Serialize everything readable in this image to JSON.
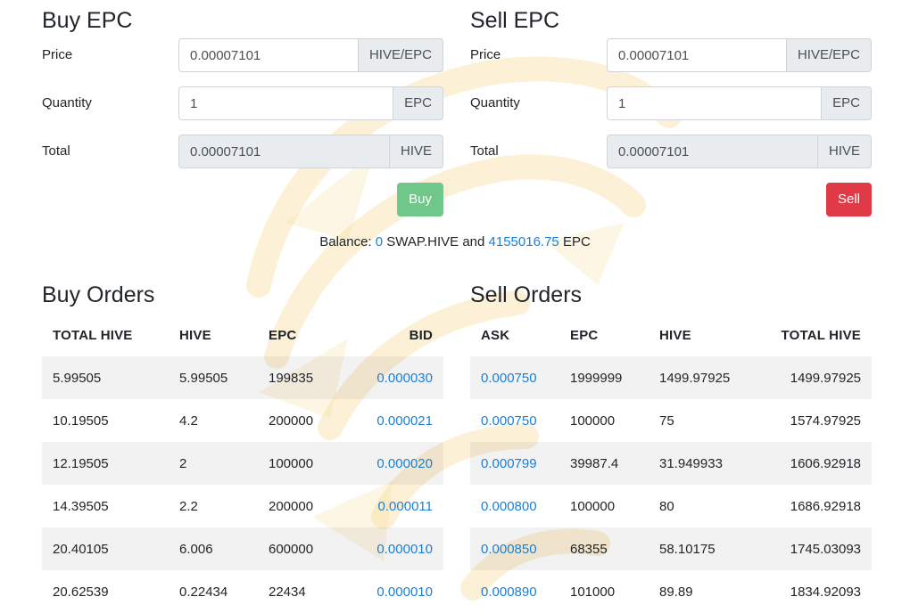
{
  "buy_form": {
    "title": "Buy EPC",
    "price_label": "Price",
    "price_value": "0.00007101",
    "price_unit": "HIVE/EPC",
    "quantity_label": "Quantity",
    "quantity_value": "1",
    "quantity_unit": "EPC",
    "total_label": "Total",
    "total_value": "0.00007101",
    "total_unit": "HIVE",
    "button_label": "Buy"
  },
  "sell_form": {
    "title": "Sell EPC",
    "price_label": "Price",
    "price_value": "0.00007101",
    "price_unit": "HIVE/EPC",
    "quantity_label": "Quantity",
    "quantity_value": "1",
    "quantity_unit": "EPC",
    "total_label": "Total",
    "total_value": "0.00007101",
    "total_unit": "HIVE",
    "button_label": "Sell"
  },
  "balance": {
    "label": "Balance:",
    "swap_hive_amount": "0",
    "swap_hive_token": "SWAP.HIVE",
    "joiner": "and",
    "epc_amount": "4155016.75",
    "epc_token": "EPC"
  },
  "buy_orders": {
    "title": "Buy Orders",
    "columns": [
      "TOTAL HIVE",
      "HIVE",
      "EPC",
      "BID"
    ],
    "rows": [
      [
        "5.99505",
        "5.99505",
        "199835",
        "0.000030"
      ],
      [
        "10.19505",
        "4.2",
        "200000",
        "0.000021"
      ],
      [
        "12.19505",
        "2",
        "100000",
        "0.000020"
      ],
      [
        "14.39505",
        "2.2",
        "200000",
        "0.000011"
      ],
      [
        "20.40105",
        "6.006",
        "600000",
        "0.000010"
      ],
      [
        "20.62539",
        "0.22434",
        "22434",
        "0.000010"
      ]
    ]
  },
  "sell_orders": {
    "title": "Sell Orders",
    "columns": [
      "ASK",
      "EPC",
      "HIVE",
      "TOTAL HIVE"
    ],
    "rows": [
      [
        "0.000750",
        "1999999",
        "1499.97925",
        "1499.97925"
      ],
      [
        "0.000750",
        "100000",
        "75",
        "1574.97925"
      ],
      [
        "0.000799",
        "39987.4",
        "31.949933",
        "1606.92918"
      ],
      [
        "0.000800",
        "100000",
        "80",
        "1686.92918"
      ],
      [
        "0.000850",
        "68355",
        "58.10175",
        "1745.03093"
      ],
      [
        "0.000890",
        "101000",
        "89.89",
        "1834.92093"
      ]
    ]
  },
  "colors": {
    "link": "#1a7fd8",
    "buy_button": "#6fc78a",
    "sell_button": "#e03a46",
    "watermark": "#f6d27a"
  },
  "icons": {
    "watermark": "lion-head-watermark"
  }
}
